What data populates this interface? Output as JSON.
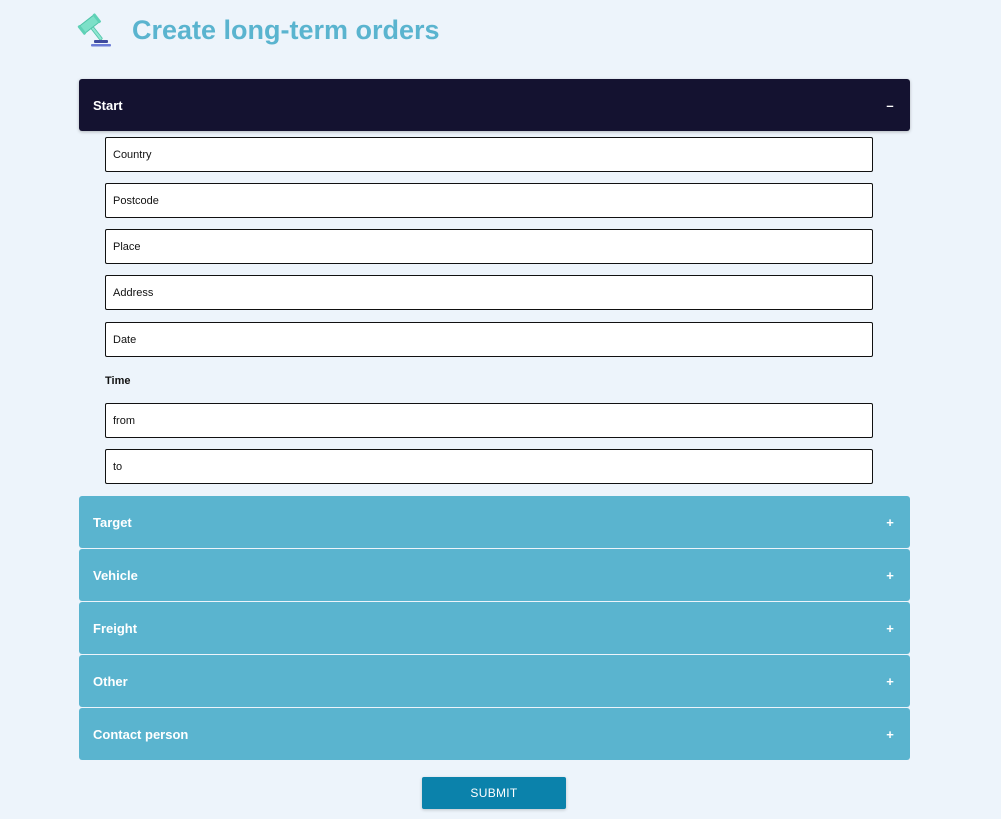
{
  "header": {
    "title": "Create long-term orders",
    "logo_icon": "gavel-icon"
  },
  "accordion": {
    "start": {
      "label": "Start",
      "toggle": "–",
      "fields": {
        "country": {
          "placeholder": "Country",
          "value": ""
        },
        "postcode": {
          "placeholder": "Postcode",
          "value": ""
        },
        "place": {
          "placeholder": "Place",
          "value": ""
        },
        "address": {
          "placeholder": "Address",
          "value": ""
        },
        "date": {
          "placeholder": "Date",
          "value": ""
        }
      },
      "time_label": "Time",
      "time_from": {
        "placeholder": "from",
        "value": ""
      },
      "time_to": {
        "placeholder": "to",
        "value": ""
      }
    },
    "sections": [
      {
        "label": "Target",
        "toggle": "+"
      },
      {
        "label": "Vehicle",
        "toggle": "+"
      },
      {
        "label": "Freight",
        "toggle": "+"
      },
      {
        "label": "Other",
        "toggle": "+"
      },
      {
        "label": "Contact person",
        "toggle": "+"
      }
    ]
  },
  "submit": {
    "label": "SUBMIT"
  },
  "colors": {
    "background": "#edf4fb",
    "title": "#5ab4cf",
    "open_header": "#141230",
    "closed_header": "#5ab4cf",
    "submit": "#0b82ab"
  }
}
